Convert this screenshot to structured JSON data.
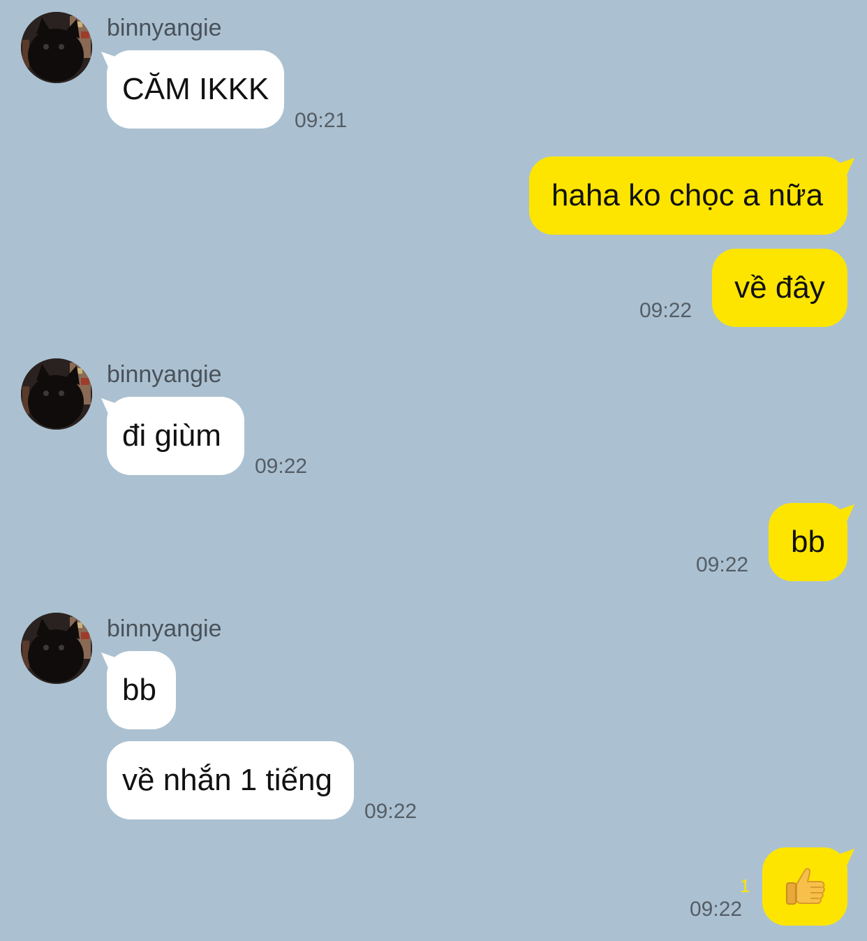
{
  "chat": {
    "messages": [
      {
        "sender": "binnyangie",
        "text": "CĂM IKKK",
        "time": "09:21"
      },
      {
        "text": "haha ko chọc a nữa"
      },
      {
        "text": "về đây",
        "time": "09:22"
      },
      {
        "sender": "binnyangie",
        "text": "đi giùm",
        "time": "09:22"
      },
      {
        "text": "bb",
        "time": "09:22"
      },
      {
        "sender": "binnyangie",
        "text": "bb"
      },
      {
        "text": "về nhắn 1 tiếng",
        "time": "09:22"
      },
      {
        "emoji": "thumbs-up-emoji",
        "unread_count": "1",
        "time": "09:22"
      }
    ]
  },
  "colors": {
    "background": "#abc1d1",
    "outgoing_bubble": "#fee500",
    "incoming_bubble": "#ffffff",
    "timestamp": "#555d66",
    "unread_count": "#fee500"
  }
}
